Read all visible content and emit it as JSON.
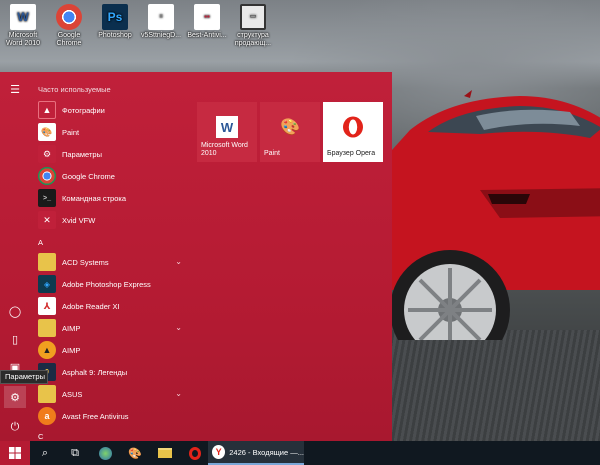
{
  "desktop": {
    "icons": [
      {
        "label": "Microsoft Word 2010",
        "icon": "word-icon",
        "color": "#2b5797"
      },
      {
        "label": "Google Chrome",
        "icon": "chrome-icon",
        "color": "#4285f4"
      },
      {
        "label": "Photoshop",
        "icon": "photoshop-icon",
        "color": "#0b2f4e"
      },
      {
        "label": "v5SttniegD...",
        "icon": "document-icon",
        "color": "#ffffff"
      },
      {
        "label": "Best-Antivi...",
        "icon": "document-icon",
        "color": "#ffffff"
      },
      {
        "label": "структура продающ...",
        "icon": "screen-doc-icon",
        "color": "#ffffff"
      }
    ]
  },
  "start_menu": {
    "accent": "#b51b33",
    "most_used_header": "Часто используемые",
    "most_used": [
      {
        "label": "Фотографии",
        "icon": "photos-icon",
        "bg": "#c0203a"
      },
      {
        "label": "Paint",
        "icon": "paint-icon",
        "bg": "#ffffff"
      },
      {
        "label": "Параметры",
        "icon": "gear-icon",
        "bg": "#c0203a"
      },
      {
        "label": "Google Chrome",
        "icon": "chrome-icon",
        "bg": "#ffffff"
      },
      {
        "label": "Командная строка",
        "icon": "cmd-icon",
        "bg": "#1a1a1a"
      },
      {
        "label": "Xvid VFW",
        "icon": "xvid-icon",
        "bg": "#c0203a"
      }
    ],
    "letter_a": "A",
    "a_apps": [
      {
        "label": "ACD Systems",
        "icon": "folder-icon",
        "bg": "#e8c34a",
        "expandable": true
      },
      {
        "label": "Adobe Photoshop Express",
        "icon": "ps-express-icon",
        "bg": "#0e3a4f",
        "expandable": false
      },
      {
        "label": "Adobe Reader XI",
        "icon": "pdf-icon",
        "bg": "#ffffff",
        "expandable": false
      },
      {
        "label": "AIMP",
        "icon": "folder-icon",
        "bg": "#e8c34a",
        "expandable": true
      },
      {
        "label": "AIMP",
        "icon": "aimp-icon",
        "bg": "#f0a020",
        "expandable": false
      },
      {
        "label": "Asphalt 9: Легенды",
        "icon": "asphalt-icon",
        "bg": "#1c2b44",
        "expandable": false
      },
      {
        "label": "ASUS",
        "icon": "folder-icon",
        "bg": "#e8c34a",
        "expandable": true
      },
      {
        "label": "Avast Free Antivirus",
        "icon": "avast-icon",
        "bg": "#f07c1b",
        "expandable": false
      }
    ],
    "letter_c": "C",
    "tiles": [
      {
        "label": "Microsoft Word 2010",
        "icon": "word-icon",
        "bg": "#c62a41"
      },
      {
        "label": "Paint",
        "icon": "paint-icon",
        "bg": "#c62a41"
      },
      {
        "label": "Браузер Opera",
        "icon": "opera-icon",
        "bg": "#ffffff"
      }
    ],
    "rail": {
      "hamburger": "menu-icon",
      "user": "user-icon",
      "documents": "document-icon",
      "pictures": "pictures-icon",
      "settings": "gear-icon",
      "power": "power-icon"
    },
    "tooltip": "Параметры"
  },
  "taskbar": {
    "active_task": "2426 - Входящие —..."
  }
}
